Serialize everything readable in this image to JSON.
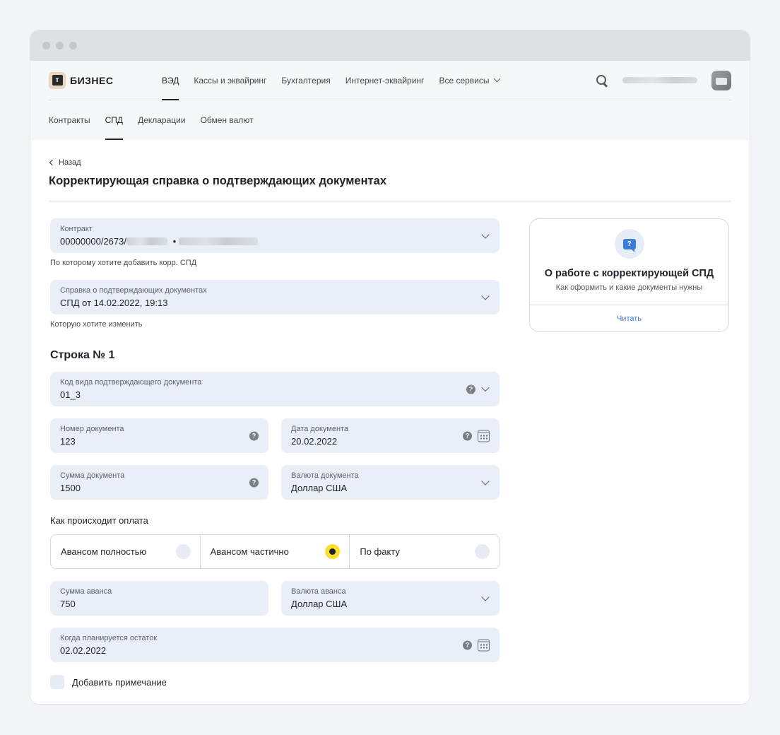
{
  "logo": {
    "mark": "т",
    "text": "БИЗНЕС"
  },
  "topnav": {
    "items": [
      "ВЭД",
      "Кассы и эквайринг",
      "Бухгалтерия",
      "Интернет-эквайринг",
      "Все сервисы"
    ]
  },
  "subnav": {
    "items": [
      "Контракты",
      "СПД",
      "Декларации",
      "Обмен валют"
    ]
  },
  "page": {
    "back_label": "Назад",
    "title": "Корректирующая справка о подтверждающих документах"
  },
  "form": {
    "contract": {
      "label": "Контракт",
      "value_prefix": "00000000/2673/",
      "separator": "•",
      "hint": "По которому хотите добавить корр. СПД"
    },
    "certificate": {
      "label": "Справка о подтверждающих документах",
      "value": "СПД от 14.02.2022, 19:13",
      "hint": "Которую хотите изменить"
    },
    "row_title": "Строка № 1",
    "doc_code": {
      "label": "Код вида подтверждающего документа",
      "value": "01_3"
    },
    "doc_number": {
      "label": "Номер документа",
      "value": "123"
    },
    "doc_date": {
      "label": "Дата документа",
      "value": "20.02.2022"
    },
    "doc_sum": {
      "label": "Сумма документа",
      "value": "1500"
    },
    "doc_currency": {
      "label": "Валюта документа",
      "value": "Доллар США"
    },
    "payment": {
      "title": "Как происходит оплата",
      "options": [
        "Авансом полностью",
        "Авансом частично",
        "По факту"
      ],
      "selected_index": 1
    },
    "advance_sum": {
      "label": "Сумма аванса",
      "value": "750"
    },
    "advance_currency": {
      "label": "Валюта аванса",
      "value": "Доллар США"
    },
    "remainder_date": {
      "label": "Когда планируется остаток",
      "value": "02.02.2022"
    },
    "add_note_label": "Добавить примечание"
  },
  "info_card": {
    "icon": "?",
    "title": "О работе с корректирующей СПД",
    "subtitle": "Как оформить и какие документы нужны",
    "link": "Читать"
  },
  "colors": {
    "accent_yellow": "#ffdd2d",
    "link_blue": "#3b7bd9",
    "field_bg": "#eaeff7"
  }
}
